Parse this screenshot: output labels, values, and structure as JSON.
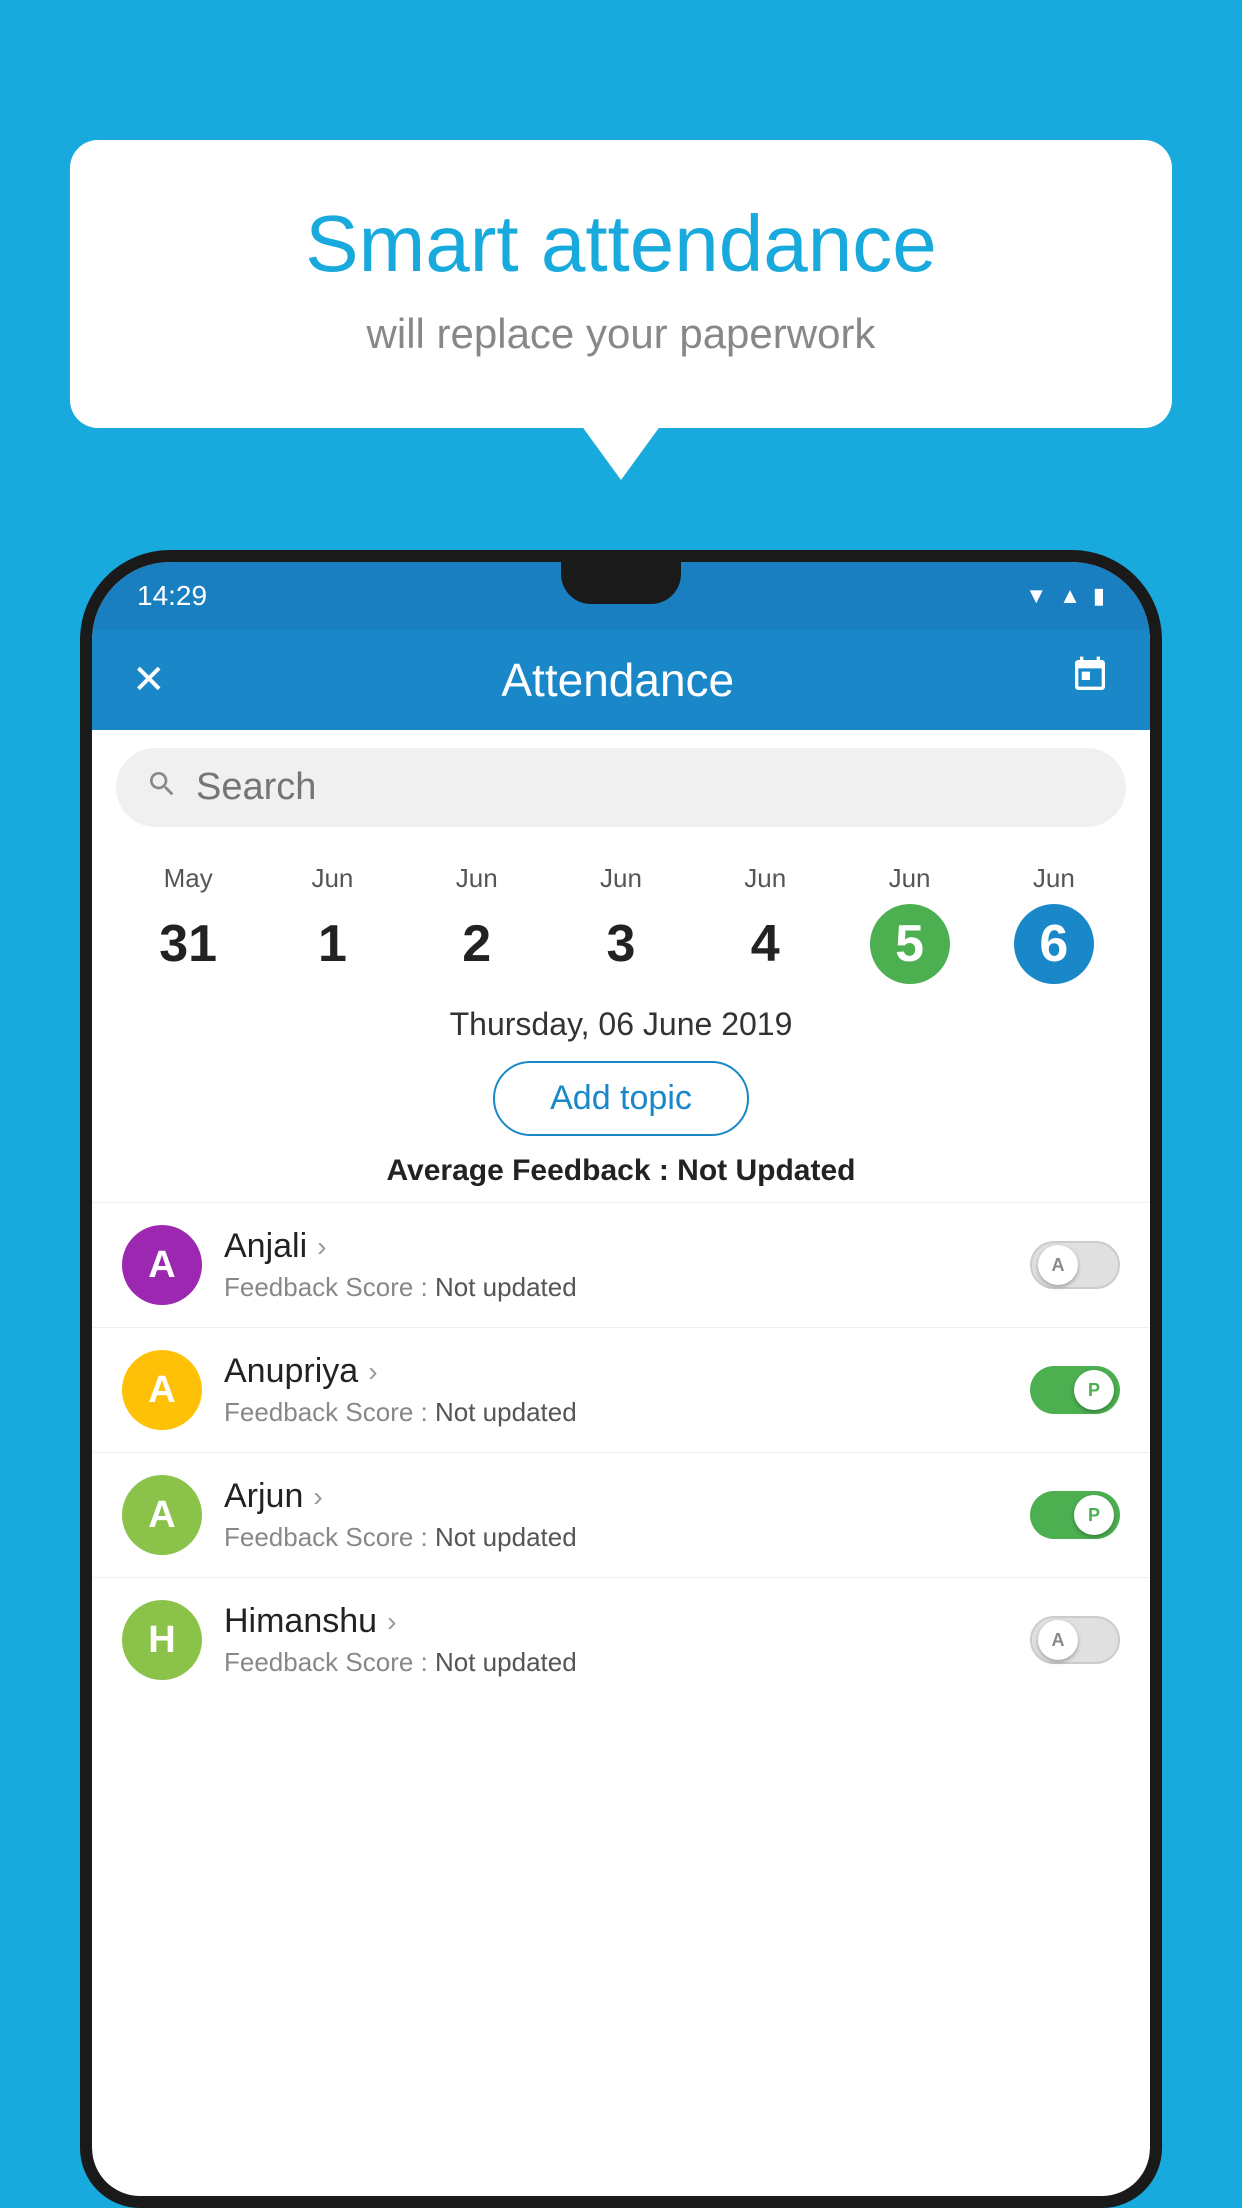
{
  "background_color": "#19AADD",
  "speech_bubble": {
    "title": "Smart attendance",
    "subtitle": "will replace your paperwork"
  },
  "status_bar": {
    "time": "14:29",
    "icons": [
      "wifi",
      "signal",
      "battery"
    ]
  },
  "header": {
    "title": "Attendance",
    "close_label": "✕",
    "calendar_label": "📅"
  },
  "search": {
    "placeholder": "Search"
  },
  "calendar": {
    "days": [
      {
        "month": "May",
        "date": "31",
        "state": "normal"
      },
      {
        "month": "Jun",
        "date": "1",
        "state": "normal"
      },
      {
        "month": "Jun",
        "date": "2",
        "state": "normal"
      },
      {
        "month": "Jun",
        "date": "3",
        "state": "normal"
      },
      {
        "month": "Jun",
        "date": "4",
        "state": "normal"
      },
      {
        "month": "Jun",
        "date": "5",
        "state": "today"
      },
      {
        "month": "Jun",
        "date": "6",
        "state": "selected"
      }
    ]
  },
  "selected_date_label": "Thursday, 06 June 2019",
  "add_topic_label": "Add topic",
  "avg_feedback_prefix": "Average Feedback : ",
  "avg_feedback_value": "Not Updated",
  "students": [
    {
      "name": "Anjali",
      "avatar_letter": "A",
      "avatar_color": "#9C27B0",
      "feedback_label": "Feedback Score : ",
      "feedback_value": "Not updated",
      "toggle_state": "off",
      "toggle_label": "A"
    },
    {
      "name": "Anupriya",
      "avatar_letter": "A",
      "avatar_color": "#FFC107",
      "feedback_label": "Feedback Score : ",
      "feedback_value": "Not updated",
      "toggle_state": "on",
      "toggle_label": "P"
    },
    {
      "name": "Arjun",
      "avatar_letter": "A",
      "avatar_color": "#8BC34A",
      "feedback_label": "Feedback Score : ",
      "feedback_value": "Not updated",
      "toggle_state": "on",
      "toggle_label": "P"
    },
    {
      "name": "Himanshu",
      "avatar_letter": "H",
      "avatar_color": "#8BC34A",
      "feedback_label": "Feedback Score : ",
      "feedback_value": "Not updated",
      "toggle_state": "off",
      "toggle_label": "A"
    }
  ]
}
